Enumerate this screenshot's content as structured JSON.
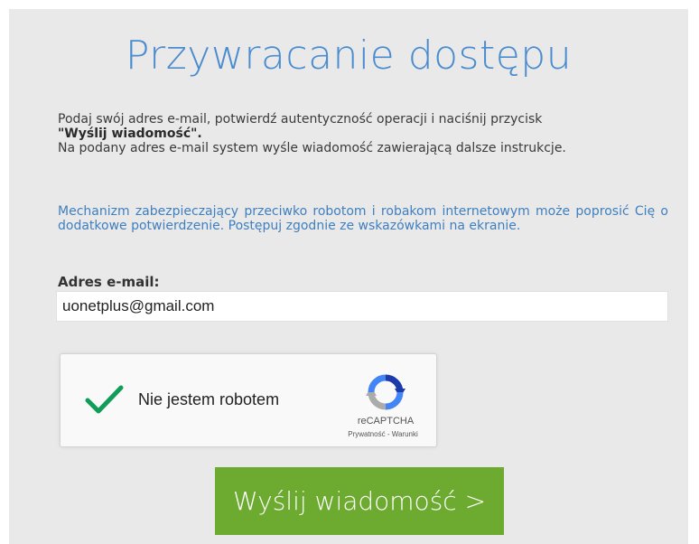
{
  "page": {
    "title": "Przywracanie dostępu"
  },
  "intro": {
    "line1": "Podaj swój adres e-mail, potwierdź autentyczność operacji i naciśnij przycisk",
    "button_ref": "\"Wyślij wiadomość\".",
    "line2": "Na podany adres e-mail system wyśle wiadomość zawierającą dalsze instrukcje."
  },
  "robot_note": "Mechanizm zabezpieczający przeciwko robotom i robakom internetowym może poprosić Cię o dodatkowe potwierdzenie. Postępuj zgodnie ze wskazówkami na ekranie.",
  "email": {
    "label": "Adres e-mail:",
    "value": "uonetplus@gmail.com"
  },
  "captcha": {
    "label": "Nie jestem robotem",
    "checked": true,
    "brand": "reCAPTCHA",
    "privacy_link": "Prywatność",
    "separator": " - ",
    "terms_link": "Warunki",
    "check_icon": "checkmark-icon",
    "logo_icon": "recaptcha-logo-icon"
  },
  "send_button": {
    "label": "Wyślij wiadomość >"
  },
  "colors": {
    "title": "#4a8ccf",
    "note": "#3f7fbf",
    "button": "#6cab2f",
    "check": "#0f9d58",
    "panel": "#e9e9e9"
  }
}
